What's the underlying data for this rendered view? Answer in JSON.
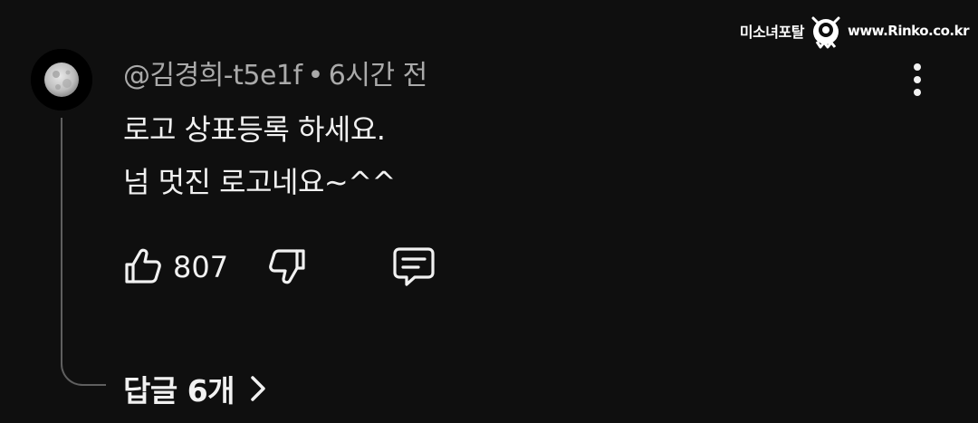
{
  "watermark": {
    "left_text": "미소녀포탈",
    "right_text": "www.Rinko.co.kr"
  },
  "comment": {
    "author": "@김경희-t5e1f",
    "separator": "•",
    "time": "6시간 전",
    "lines": [
      "로고 상표등록 하세요.",
      "넘 멋진 로고네요~^^"
    ],
    "like_count": "807",
    "replies_label": "답글 6개"
  },
  "icons": {
    "avatar": "moon-avatar",
    "more": "more-vert-icon",
    "like": "thumbs-up-icon",
    "dislike": "thumbs-down-icon",
    "reply": "comment-icon",
    "replies_chevron": "chevron-right-icon",
    "watermark_logo": "mascot-icon"
  },
  "colors": {
    "background": "#0f0f0f",
    "primary_text": "#f1f1f1",
    "secondary_text": "#aaaaaa",
    "thread_line": "#5f5f5f"
  }
}
